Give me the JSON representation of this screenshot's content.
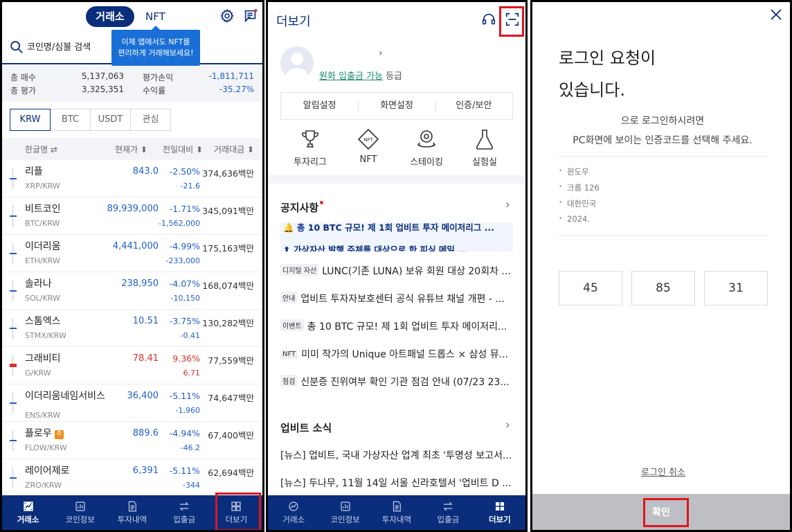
{
  "panel1": {
    "top_tabs": {
      "exchange": "거래소",
      "nft": "NFT"
    },
    "search_placeholder": "코인명/심볼 검색",
    "tooltip_line1": "이제 앱에서도 NFT를",
    "tooltip_line2": "편리하게 거래해보세요!",
    "summary": {
      "total_buy_label": "총 매수",
      "total_buy": "5,137,063",
      "total_eval_label": "총 평가",
      "total_eval": "3,325,351",
      "pl_label": "평가손익",
      "pl": "-1,811,711",
      "return_label": "수익률",
      "return": "-35.27%"
    },
    "currency_tabs": [
      "KRW",
      "BTC",
      "USDT",
      "관심"
    ],
    "columns": {
      "name": "한글명 ⇄",
      "price": "현재가 ⬍",
      "change": "전일대비 ⬍",
      "volume": "거래대금 ⬍"
    },
    "coins": [
      {
        "name": "리플",
        "symbol": "XRP/KRW",
        "price": "843.0",
        "pct": "-2.50%",
        "diff": "-21.6",
        "volume": "374,636백만"
      },
      {
        "name": "비트코인",
        "symbol": "BTC/KRW",
        "price": "89,939,000",
        "pct": "-1.71%",
        "diff": "-1,562,000",
        "volume": "345,091백만"
      },
      {
        "name": "이더리움",
        "symbol": "ETH/KRW",
        "price": "4,441,000",
        "pct": "-4.99%",
        "diff": "-233,000",
        "volume": "175,163백만"
      },
      {
        "name": "솔라나",
        "symbol": "SOL/KRW",
        "price": "238,950",
        "pct": "-4.07%",
        "diff": "-10,150",
        "volume": "168,074백만"
      },
      {
        "name": "스톰엑스",
        "symbol": "STMX/KRW",
        "price": "10.51",
        "pct": "-3.75%",
        "diff": "-0.41",
        "volume": "130,282백만"
      },
      {
        "name": "그래비티",
        "symbol": "G/KRW",
        "price": "78.41",
        "pct": "9.36%",
        "diff": "6.71",
        "volume": "77,559백만"
      },
      {
        "name": "이더리움네임서비스",
        "symbol": "ENS/KRW",
        "price": "36,400",
        "pct": "-5.11%",
        "diff": "-1,960",
        "volume": "74,647백만"
      },
      {
        "name": "플로우",
        "badge": "주",
        "symbol": "FLOW/KRW",
        "price": "889.6",
        "pct": "-4.94%",
        "diff": "-46.2",
        "volume": "67,400백만"
      },
      {
        "name": "레이어제로",
        "symbol": "ZRO/KRW",
        "price": "6,391",
        "pct": "-5.11%",
        "diff": "-344",
        "volume": "62,694백만"
      }
    ],
    "nav": [
      "거래소",
      "코인정보",
      "투자내역",
      "입출금",
      "더보기"
    ]
  },
  "panel2": {
    "title": "더보기",
    "profile_level_link": "원화 입출금 가능",
    "profile_level_suffix": " 등급",
    "settings": [
      "알림설정",
      "화면설정",
      "인증/보안"
    ],
    "features": [
      "투자리그",
      "NFT",
      "스테이킹",
      "실험실"
    ],
    "notice_title": "공지사항",
    "ticker": [
      "🔔 총 10 BTC 규모! 제 1회 업비트 투자 메이저리그 ...",
      "⬆ 가상자산 발행 주체를 대상으로 한 피싱 메일 ..."
    ],
    "notices": [
      {
        "tag": "디지털 자산",
        "text": "LUNC(기존 LUNA) 보유 회원 대상 20회차 ..."
      },
      {
        "tag": "안내",
        "text": "업비트 투자자보호센터 공식 유튜브 채널 개편 - ..."
      },
      {
        "tag": "이벤트",
        "text": "총 10 BTC 규모! 제 1회 업비트 투자 메이저리..."
      },
      {
        "tag": "NFT",
        "text": "미미 작가의 Unique 아트패널 드롭스 × 삼성 뮤..."
      },
      {
        "tag": "점검",
        "text": "신분증 진위여부 확인 기관 점검 안내 (07/23 23..."
      }
    ],
    "news_title": "업비트 소식",
    "news": [
      "[뉴스] 업비트, 국내 가상자산 업계 최초 '투명성 보고서...",
      "[뉴스] 두나무, 11월 14일 서울 신라호텔서 '업비트 D ..."
    ],
    "nav": [
      "거래소",
      "코인정보",
      "투자내역",
      "입출금",
      "더보기"
    ]
  },
  "panel3": {
    "title_line1": "로그인 요청이",
    "title_line2": "있습니다.",
    "desc_line1": "으로 로그인하시려면",
    "desc_line2": "PC화면에 보이는 인증코드를 선택해 주세요.",
    "info": [
      "윈도우",
      "크롬 126",
      "대한민국",
      "2024."
    ],
    "codes": [
      "45",
      "85",
      "31"
    ],
    "cancel": "로그인 취소",
    "confirm": "확인"
  },
  "colors": {
    "brand_navy": "#0a2e7c",
    "negative_blue": "#1f5fc9",
    "positive_red": "#d6312b",
    "highlight_red": "#e0141e"
  }
}
